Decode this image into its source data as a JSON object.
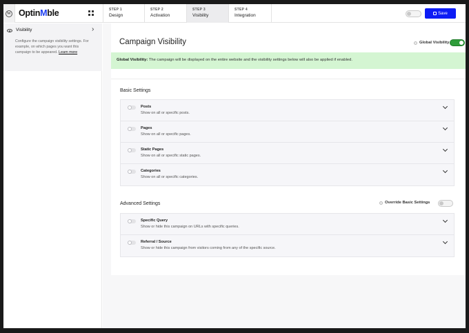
{
  "brand": {
    "logo_prefix": "Optin",
    "logo_mark": "M",
    "logo_suffix": "ble"
  },
  "steps": [
    {
      "num": "STEP 1",
      "name": "Design"
    },
    {
      "num": "STEP 2",
      "name": "Activation"
    },
    {
      "num": "STEP 3",
      "name": "Visibility"
    },
    {
      "num": "STEP 4",
      "name": "Integration"
    }
  ],
  "toolbar": {
    "save_label": "Save"
  },
  "sidebar": {
    "title": "Visibility",
    "description": "Configure the campaign visibility settings. For example, on which pages you want this campaign to be appeared.",
    "learn_more": "Learn more"
  },
  "main": {
    "title": "Campaign Visibility",
    "global_visibility_label": "Global Visibility",
    "notice_bold": "Global Visibility:",
    "notice_text": " The campaign will be displayed on the entire website and the visibility settings below will also be applied if enabled."
  },
  "basic": {
    "title": "Basic Settings",
    "rows": [
      {
        "title": "Posts",
        "desc": "Show on all or specific posts."
      },
      {
        "title": "Pages",
        "desc": "Show on all or specific pages."
      },
      {
        "title": "Static Pages",
        "desc": "Show on all or specific static pages."
      },
      {
        "title": "Categories",
        "desc": "Show on all or specific categories."
      }
    ]
  },
  "advanced": {
    "title": "Advanced Settings",
    "override_label": "Override Basic Settings",
    "rows": [
      {
        "title": "Specific Query",
        "desc": "Show or hide this campaign on URLs with specific queries."
      },
      {
        "title": "Referral / Source",
        "desc": "Show or hide this campaign from visitors coming from any of the specific source."
      }
    ]
  },
  "colors": {
    "accent": "#0d1cf5",
    "success": "#2e9c3a",
    "notice_bg": "#d4f5d2"
  }
}
